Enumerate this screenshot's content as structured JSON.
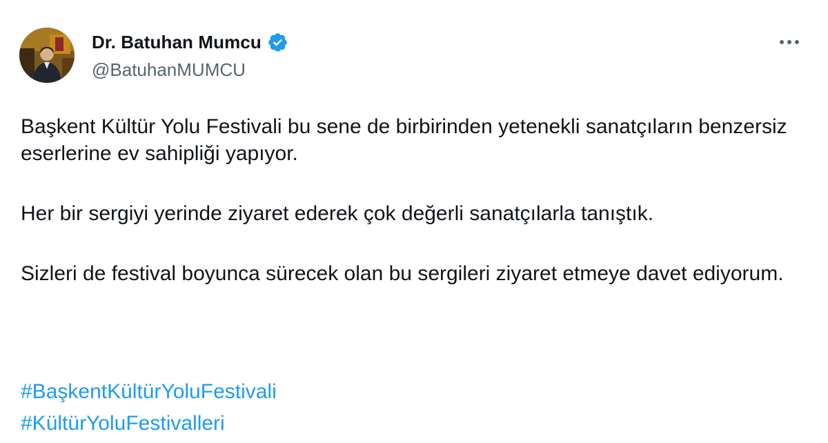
{
  "author": {
    "display_name": "Dr. Batuhan Mumcu",
    "handle": "@BatuhanMUMCU",
    "verified_icon": "verified-badge-icon",
    "verified_color": "#1d9bf0"
  },
  "menu": {
    "icon": "more-horizontal-icon"
  },
  "tweet": {
    "paragraphs": [
      "Başkent Kültür Yolu Festivali bu sene de birbirinden yetenekli sanatçıların benzersiz eserlerine ev sahipliği yapıyor.",
      "Her bir sergiyi yerinde ziyaret ederek çok değerli sanatçılarla tanıştık.",
      "Sizleri de festival boyunca sürecek olan bu sergileri ziyaret etmeye davet ediyorum."
    ],
    "hashtags": [
      "#BaşkentKültürYoluFestivali",
      "#KültürYoluFestivalleri"
    ]
  },
  "colors": {
    "text": "#0f1419",
    "secondary": "#536471",
    "link": "#1d9bf0"
  }
}
